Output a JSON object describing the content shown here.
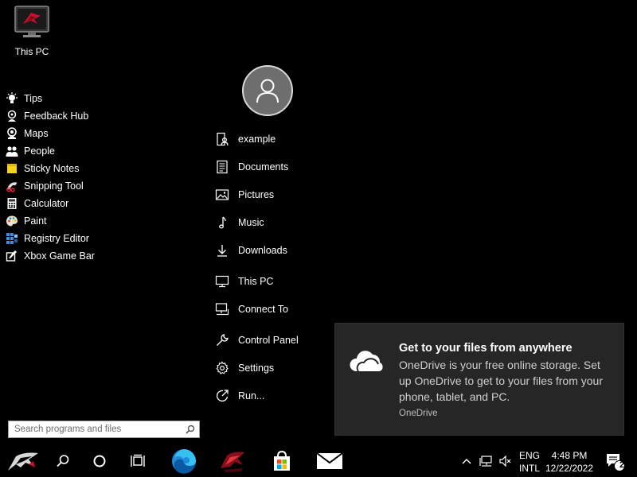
{
  "desktop": {
    "icons": [
      {
        "label": "This PC",
        "icon": "rog-pc-icon"
      }
    ]
  },
  "start_menu": {
    "programs": [
      {
        "label": "Tips",
        "icon": "lightbulb-icon"
      },
      {
        "label": "Feedback Hub",
        "icon": "feedback-icon"
      },
      {
        "label": "Maps",
        "icon": "maps-icon"
      },
      {
        "label": "People",
        "icon": "people-icon"
      },
      {
        "label": "Sticky Notes",
        "icon": "sticky-notes-icon"
      },
      {
        "label": "Snipping Tool",
        "icon": "scissors-icon"
      },
      {
        "label": "Calculator",
        "icon": "calculator-icon"
      },
      {
        "label": "Paint",
        "icon": "paint-palette-icon"
      },
      {
        "label": "Registry Editor",
        "icon": "registry-icon"
      },
      {
        "label": "Xbox Game Bar",
        "icon": "xbox-icon"
      }
    ],
    "search": {
      "placeholder": "Search programs and files"
    },
    "places": [
      {
        "label": "example",
        "icon": "user-folder-icon"
      },
      {
        "label": "Documents",
        "icon": "document-icon"
      },
      {
        "label": "Pictures",
        "icon": "picture-icon"
      },
      {
        "label": "Music",
        "icon": "music-icon"
      },
      {
        "label": "Downloads",
        "icon": "download-icon"
      },
      {
        "label": "This PC",
        "icon": "monitor-icon"
      },
      {
        "label": "Connect To",
        "icon": "connect-icon"
      },
      {
        "label": "Control Panel",
        "icon": "wrench-icon"
      },
      {
        "label": "Settings",
        "icon": "gear-icon"
      },
      {
        "label": "Run...",
        "icon": "run-icon"
      }
    ]
  },
  "notification": {
    "title": "Get to your files from anywhere",
    "body": "OneDrive is your free online storage. Set up OneDrive to get to your files from your phone, tablet, and PC.",
    "source": "OneDrive",
    "icon": "cloud-icon"
  },
  "taskbar": {
    "apps": [
      "rog-start-icon",
      "search-icon",
      "cortana-icon",
      "task-view-icon",
      "edge-icon",
      "rog-app-icon",
      "store-icon",
      "mail-icon"
    ],
    "tray": {
      "lang_top": "ENG",
      "lang_bottom": "INTL",
      "time": "4:48 PM",
      "date": "12/22/2022",
      "notification_count": "2"
    }
  },
  "colors": {
    "background": "#000000",
    "toast_background": "#262626",
    "edge_blue": "#1f8ad8",
    "rog_red": "#c8102e"
  }
}
